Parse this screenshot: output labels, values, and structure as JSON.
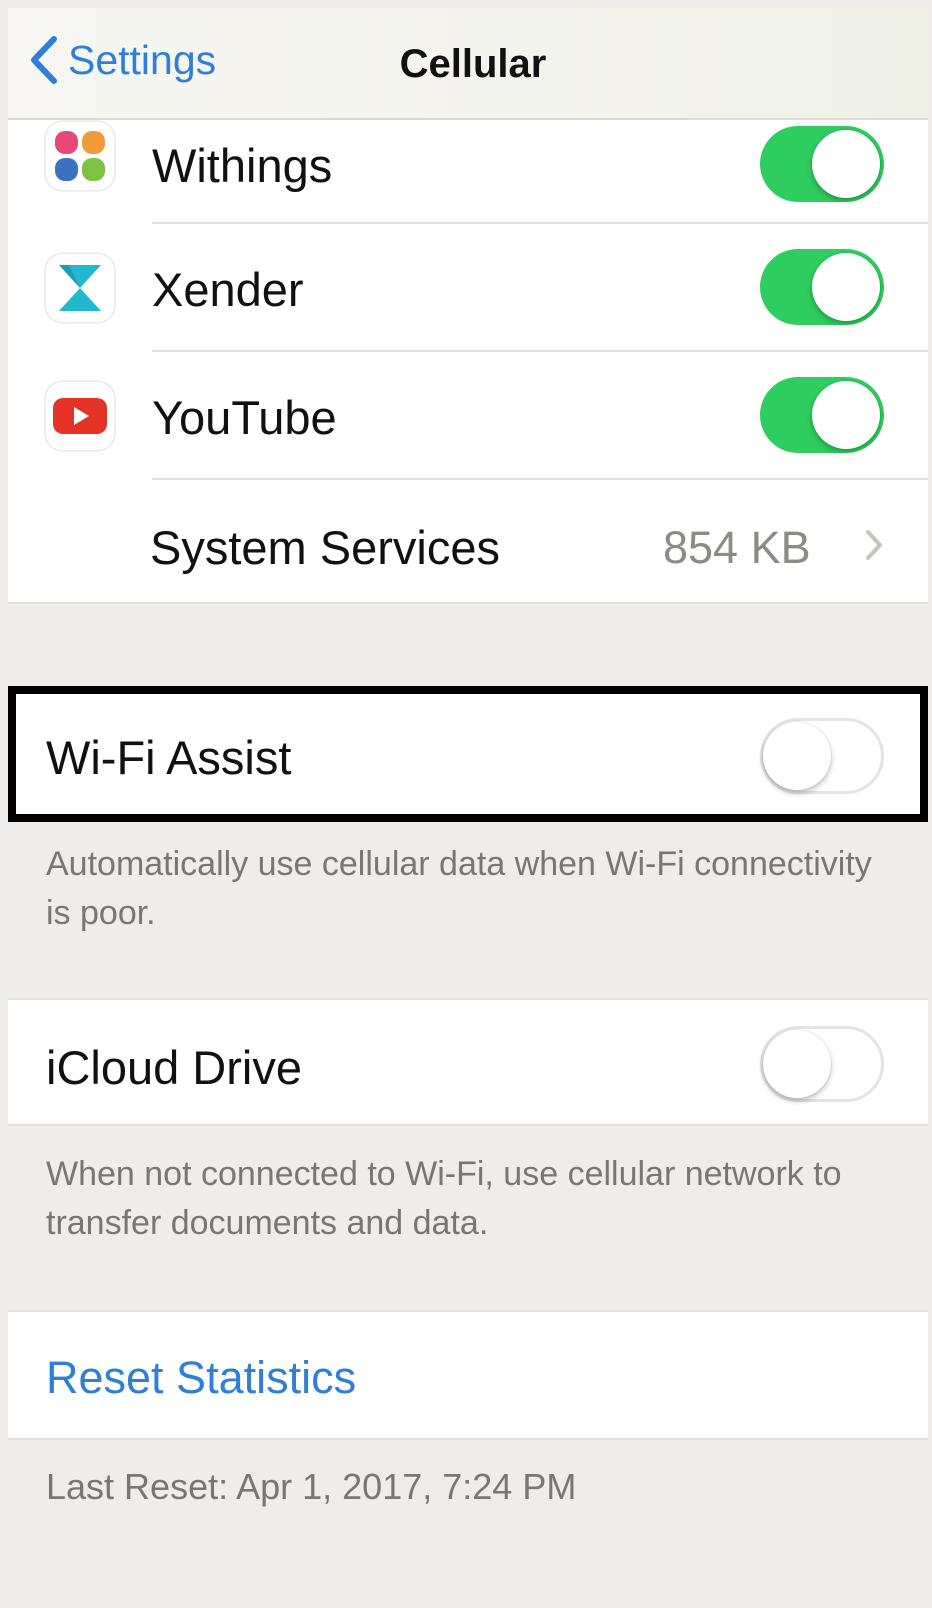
{
  "nav": {
    "back_label": "Settings",
    "title": "Cellular"
  },
  "apps": [
    {
      "name": "Withings",
      "icon": "withings-app-icon",
      "enabled": true
    },
    {
      "name": "Xender",
      "icon": "xender-app-icon",
      "enabled": true
    },
    {
      "name": "YouTube",
      "icon": "youtube-app-icon",
      "enabled": true
    }
  ],
  "system_services": {
    "label": "System Services",
    "value": "854 KB"
  },
  "wifi_assist": {
    "label": "Wi-Fi Assist",
    "enabled": false,
    "footer": "Automatically use cellular data when Wi-Fi connectivity is poor."
  },
  "icloud_drive": {
    "label": "iCloud Drive",
    "enabled": false,
    "footer": "When not connected to Wi-Fi, use cellular network to transfer documents and data."
  },
  "reset": {
    "label": "Reset Statistics",
    "last_reset": "Last Reset: Apr 1, 2017, 7:24 PM"
  },
  "colors": {
    "tint": "#2f7fd6",
    "switch_on": "#2ecd5f",
    "group_bg": "#efecea"
  }
}
